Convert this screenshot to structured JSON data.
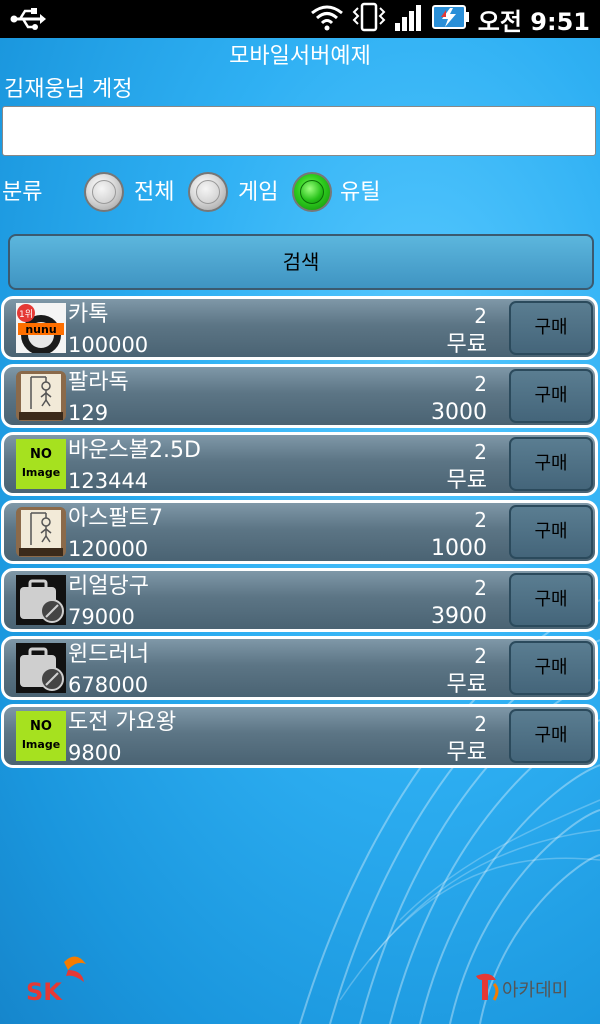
{
  "status_bar": {
    "time": "오전 9:51",
    "icons": [
      "usb-icon",
      "wifi-icon",
      "vibrate-icon",
      "signal-icon",
      "battery-icon"
    ]
  },
  "app": {
    "title": "모바일서버예제"
  },
  "account": {
    "label": "김재웅님 계정",
    "value": ""
  },
  "category": {
    "label": "분류",
    "options": [
      {
        "label": "전체",
        "checked": false
      },
      {
        "label": "게임",
        "checked": false
      },
      {
        "label": "유틸",
        "checked": true
      }
    ]
  },
  "search": {
    "label": "검색"
  },
  "items": [
    {
      "name": "카톡",
      "count": "100000",
      "num": "2",
      "price": "무료",
      "buy": "구매",
      "icon": "nunu-game-icon"
    },
    {
      "name": "팔라독",
      "count": "129",
      "num": "2",
      "price": "3000",
      "buy": "구매",
      "icon": "hangman-icon"
    },
    {
      "name": "바운스볼2.5D",
      "count": "123444",
      "num": "2",
      "price": "무료",
      "buy": "구매",
      "icon": "no-image-icon",
      "thumb_text": [
        "NO",
        "Image"
      ]
    },
    {
      "name": "아스팔트7",
      "count": "120000",
      "num": "2",
      "price": "1000",
      "buy": "구매",
      "icon": "hangman-icon"
    },
    {
      "name": "리얼당구",
      "count": "79000",
      "num": "2",
      "price": "3900",
      "buy": "구매",
      "icon": "app-placeholder-icon"
    },
    {
      "name": "윈드러너",
      "count": "678000",
      "num": "2",
      "price": "무료",
      "buy": "구매",
      "icon": "app-placeholder-icon"
    },
    {
      "name": "도전 가요왕",
      "count": "9800",
      "num": "2",
      "price": "무료",
      "buy": "구매",
      "icon": "no-image-icon",
      "thumb_text": [
        "NO",
        "Image"
      ]
    }
  ],
  "footer": {
    "left_logo": "SK",
    "right_logo": "아카데미"
  },
  "colors": {
    "accent_green": "#2ecc1e",
    "background": "#2fb0f3",
    "item_bg": "#5c7585"
  }
}
